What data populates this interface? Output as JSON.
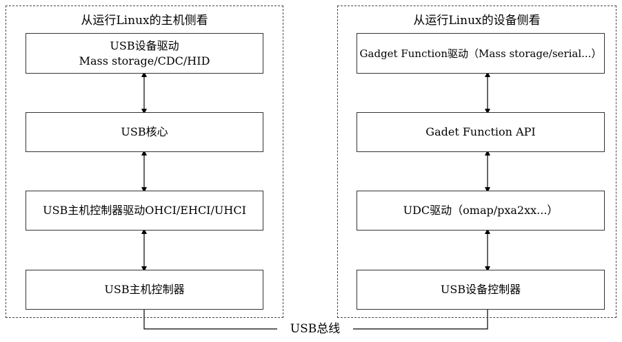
{
  "left_panel": {
    "title": "从运行Linux的主机侧看",
    "boxes": [
      {
        "line1": "USB设备驱动",
        "line2": "Mass storage/CDC/HID"
      },
      {
        "line1": "USB核心",
        "line2": ""
      },
      {
        "line1": "USB主机控制器驱动OHCI/EHCI/UHCI",
        "line2": ""
      },
      {
        "line1": "USB主机控制器",
        "line2": ""
      }
    ]
  },
  "right_panel": {
    "title": "从运行Linux的设备侧看",
    "boxes": [
      {
        "line1": "Gadget Function驱动（Mass storage/serial...）",
        "line2": ""
      },
      {
        "line1": "Gadet Function API",
        "line2": ""
      },
      {
        "line1": "UDC驱动（omap/pxa2xx...）",
        "line2": ""
      },
      {
        "line1": "USB设备控制器",
        "line2": ""
      }
    ]
  },
  "bus": {
    "label": "USB总线"
  }
}
